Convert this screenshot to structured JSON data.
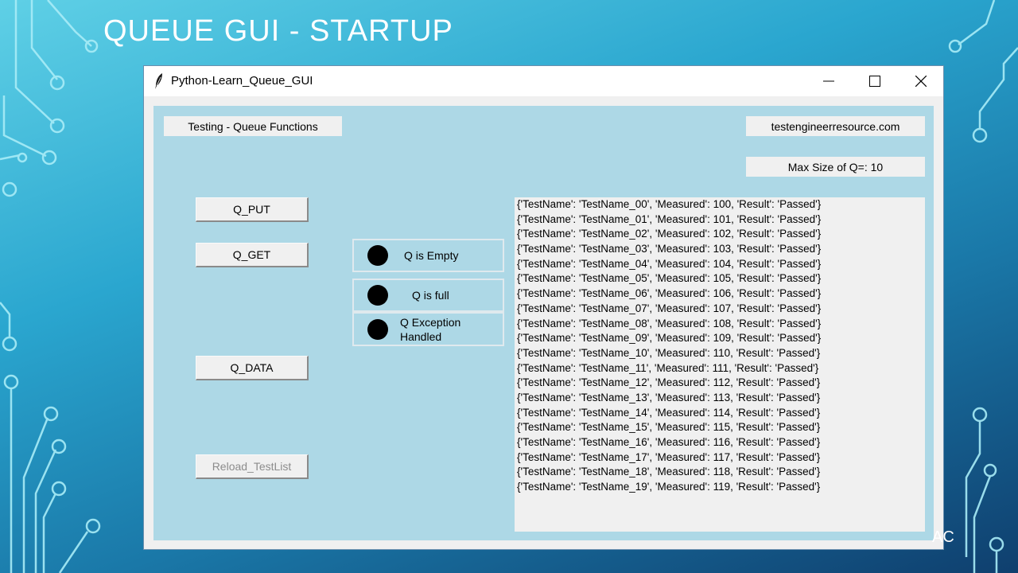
{
  "slide": {
    "title": "QUEUE GUI - STARTUP",
    "corner_mark": "AC"
  },
  "window": {
    "title": "Python-Learn_Queue_GUI",
    "app_icon": "feather-icon",
    "controls": [
      "minimize-icon",
      "maximize-icon",
      "close-icon"
    ]
  },
  "labels": {
    "testing": "Testing - Queue Functions",
    "website": "testengineerresource.com",
    "maxsize": "Max Size of Q=: 10"
  },
  "buttons": {
    "put": "Q_PUT",
    "get": "Q_GET",
    "data": "Q_DATA",
    "reload": "Reload_TestList"
  },
  "indicators": {
    "empty": "Q is Empty",
    "full": "Q is full",
    "exception_line1": "Q Exception",
    "exception_line2": "Handled"
  },
  "listbox": {
    "rows": [
      "{'TestName': 'TestName_00', 'Measured': 100, 'Result': 'Passed'}",
      "{'TestName': 'TestName_01', 'Measured': 101, 'Result': 'Passed'}",
      "{'TestName': 'TestName_02', 'Measured': 102, 'Result': 'Passed'}",
      "{'TestName': 'TestName_03', 'Measured': 103, 'Result': 'Passed'}",
      "{'TestName': 'TestName_04', 'Measured': 104, 'Result': 'Passed'}",
      "{'TestName': 'TestName_05', 'Measured': 105, 'Result': 'Passed'}",
      "{'TestName': 'TestName_06', 'Measured': 106, 'Result': 'Passed'}",
      "{'TestName': 'TestName_07', 'Measured': 107, 'Result': 'Passed'}",
      "{'TestName': 'TestName_08', 'Measured': 108, 'Result': 'Passed'}",
      "{'TestName': 'TestName_09', 'Measured': 109, 'Result': 'Passed'}",
      "{'TestName': 'TestName_10', 'Measured': 110, 'Result': 'Passed'}",
      "{'TestName': 'TestName_11', 'Measured': 111, 'Result': 'Passed'}",
      "{'TestName': 'TestName_12', 'Measured': 112, 'Result': 'Passed'}",
      "{'TestName': 'TestName_13', 'Measured': 113, 'Result': 'Passed'}",
      "{'TestName': 'TestName_14', 'Measured': 114, 'Result': 'Passed'}",
      "{'TestName': 'TestName_15', 'Measured': 115, 'Result': 'Passed'}",
      "{'TestName': 'TestName_16', 'Measured': 116, 'Result': 'Passed'}",
      "{'TestName': 'TestName_17', 'Measured': 117, 'Result': 'Passed'}",
      "{'TestName': 'TestName_18', 'Measured': 118, 'Result': 'Passed'}",
      "{'TestName': 'TestName_19', 'Measured': 119, 'Result': 'Passed'}"
    ]
  },
  "colors": {
    "client_background": "#add8e6",
    "widget_background": "#f0f0f0",
    "indicator_off": "#000000"
  }
}
